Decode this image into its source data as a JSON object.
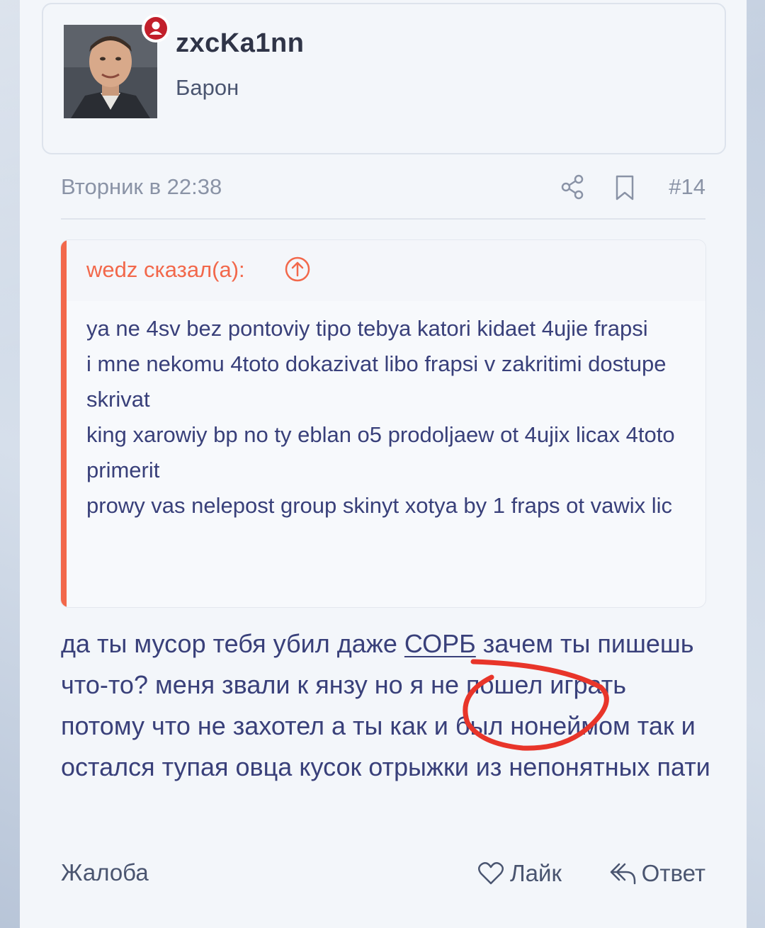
{
  "user": {
    "name": "zxcKa1nn",
    "title": "Барон"
  },
  "post": {
    "date": "Вторник в 22:38",
    "number": "#14"
  },
  "quote": {
    "author": "wedz сказал(а):",
    "lines": [
      "ya ne 4sv bez pontoviy tipo tebya katori kidaet 4ujie frapsi",
      "i mne nekomu 4toto dokazivat libo frapsi v zakritimi dostupe skrivat",
      "king xarowiy bp no ty eblan o5 prodoljaew ot 4ujix licax 4toto primerit",
      "prowy vas nelepost group skinyt xotya by 1 fraps ot vawix lic"
    ]
  },
  "message": {
    "before": "да ты мусор тебя убил даже ",
    "underlined": "СОРБ",
    "after": " зачем ты пишешь что-то? меня звали к янзу но я не пошел играть потому что не захотел а ты как и был нонеймом так и остался тупая овца кусок отрыжки из непонятных пати"
  },
  "actions": {
    "report": "Жалоба",
    "like": "Лайк",
    "reply": "Ответ"
  },
  "colors": {
    "accent": "#f2684b",
    "text": "#39407a",
    "muted": "#8a93a6",
    "online_badge": "#c21f2b",
    "annotation": "#e8352a"
  }
}
